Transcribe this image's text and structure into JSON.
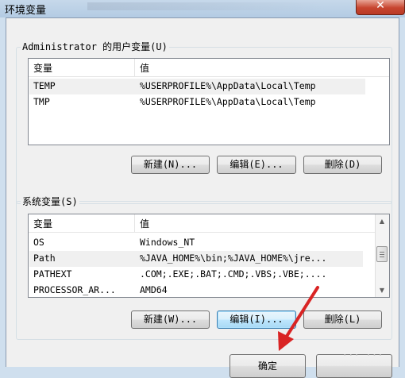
{
  "window": {
    "title": "环境变量",
    "close_glyph": "✕"
  },
  "user_vars": {
    "group_label": "Administrator 的用户变量(U)",
    "columns": [
      "变量",
      "值"
    ],
    "rows": [
      {
        "name": "TEMP",
        "value": "%USERPROFILE%\\AppData\\Local\\Temp",
        "selected": true
      },
      {
        "name": "TMP",
        "value": "%USERPROFILE%\\AppData\\Local\\Temp",
        "selected": false
      }
    ],
    "buttons": {
      "new": "新建(N)...",
      "edit": "编辑(E)...",
      "delete": "删除(D)"
    }
  },
  "system_vars": {
    "group_label": "系统变量(S)",
    "columns": [
      "变量",
      "值"
    ],
    "rows": [
      {
        "name": "OS",
        "value": "Windows_NT",
        "selected": false
      },
      {
        "name": "Path",
        "value": "%JAVA_HOME%\\bin;%JAVA_HOME%\\jre...",
        "selected": true
      },
      {
        "name": "PATHEXT",
        "value": ".COM;.EXE;.BAT;.CMD;.VBS;.VBE;....",
        "selected": false
      },
      {
        "name": "PROCESSOR_AR...",
        "value": "AMD64",
        "selected": false
      }
    ],
    "buttons": {
      "new": "新建(W)...",
      "edit": "编辑(I)...",
      "delete": "删除(L)"
    }
  },
  "footer": {
    "ok": "确定"
  },
  "colors": {
    "arrow": "#d92424",
    "focus_border": "#3c7fb1"
  }
}
